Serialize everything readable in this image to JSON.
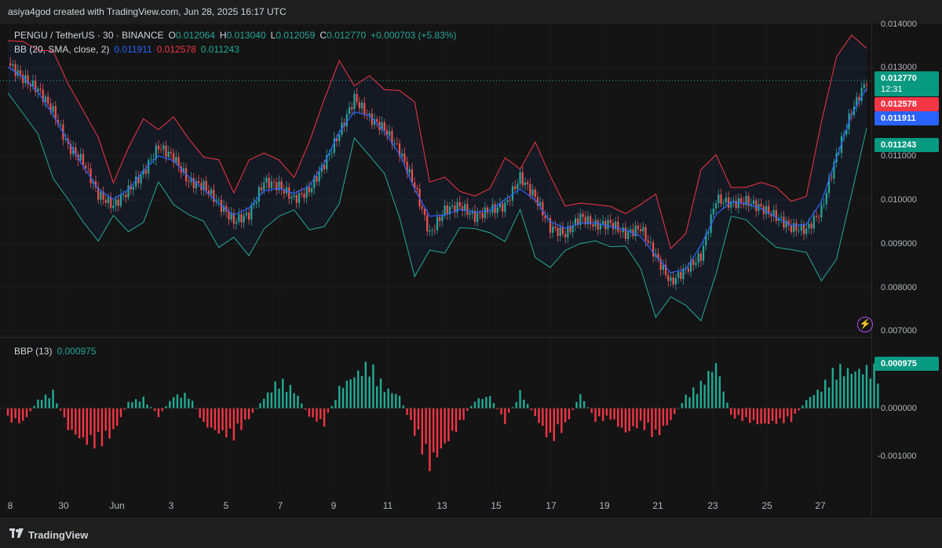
{
  "header": {
    "caption": "asiya4god created with TradingView.com, Jun 28, 2025 16:17 UTC"
  },
  "legend": {
    "symbol": "PENGU / TetherUS · 30 · BINANCE",
    "o_label": "O",
    "o_value": "0.012064",
    "h_label": "H",
    "h_value": "0.013040",
    "l_label": "L",
    "l_value": "0.012059",
    "c_label": "C",
    "c_value": "0.012770",
    "change": "+0.000703 (+5.83%)",
    "bb_label": "BB (20, SMA, close, 2)",
    "bb_basis": "0.011911",
    "bb_upper": "0.012578",
    "bb_lower": "0.011243",
    "bbp_label": "BBP (13)",
    "bbp_value": "0.000975"
  },
  "price_tags": {
    "last": "0.012770",
    "countdown": "12:31",
    "upper": "0.012578",
    "basis": "0.011911",
    "lower": "0.011243",
    "bbp": "0.000975"
  },
  "colors": {
    "up": "#26a69a",
    "down": "#ef5350",
    "bb_basis": "#2962ff",
    "bb_upper": "#f23645",
    "bb_lower": "#22ab94",
    "bbp_pos": "#22ab94",
    "bbp_neg": "#f23645"
  },
  "footer": {
    "brand": "TradingView"
  },
  "chart_data": [
    {
      "type": "candlestick",
      "title": "PENGU / TetherUS · 30 · BINANCE",
      "x_ticks": [
        "8",
        "30",
        "Jun",
        "3",
        "5",
        "7",
        "9",
        "11",
        "13",
        "15",
        "17",
        "19",
        "21",
        "23",
        "25",
        "27"
      ],
      "y_ticks": [
        "0.014000",
        "0.013000",
        "0.011000",
        "0.010000",
        "0.009000",
        "0.008000",
        "0.007000"
      ],
      "ylim": [
        0.007,
        0.014
      ],
      "close_series": [
        {
          "x": 0,
          "y": 0.0131
        },
        {
          "x": 1,
          "y": 0.01275
        },
        {
          "x": 2,
          "y": 0.0125
        },
        {
          "x": 3,
          "y": 0.012
        },
        {
          "x": 4,
          "y": 0.0112
        },
        {
          "x": 5,
          "y": 0.01085
        },
        {
          "x": 6,
          "y": 0.0101
        },
        {
          "x": 7,
          "y": 0.00985
        },
        {
          "x": 8,
          "y": 0.0102
        },
        {
          "x": 9,
          "y": 0.0106
        },
        {
          "x": 10,
          "y": 0.0112
        },
        {
          "x": 11,
          "y": 0.01095
        },
        {
          "x": 12,
          "y": 0.0104
        },
        {
          "x": 13,
          "y": 0.0103
        },
        {
          "x": 14,
          "y": 0.0099
        },
        {
          "x": 15,
          "y": 0.0095
        },
        {
          "x": 16,
          "y": 0.00965
        },
        {
          "x": 17,
          "y": 0.0104
        },
        {
          "x": 18,
          "y": 0.0103
        },
        {
          "x": 19,
          "y": 0.01
        },
        {
          "x": 20,
          "y": 0.0102
        },
        {
          "x": 21,
          "y": 0.0108
        },
        {
          "x": 22,
          "y": 0.0115
        },
        {
          "x": 23,
          "y": 0.0123
        },
        {
          "x": 24,
          "y": 0.01185
        },
        {
          "x": 25,
          "y": 0.0116
        },
        {
          "x": 26,
          "y": 0.0111
        },
        {
          "x": 27,
          "y": 0.0103
        },
        {
          "x": 28,
          "y": 0.0092
        },
        {
          "x": 29,
          "y": 0.00975
        },
        {
          "x": 30,
          "y": 0.00985
        },
        {
          "x": 31,
          "y": 0.0096
        },
        {
          "x": 32,
          "y": 0.00975
        },
        {
          "x": 33,
          "y": 0.00985
        },
        {
          "x": 34,
          "y": 0.0105
        },
        {
          "x": 35,
          "y": 0.01005
        },
        {
          "x": 36,
          "y": 0.00935
        },
        {
          "x": 37,
          "y": 0.0092
        },
        {
          "x": 38,
          "y": 0.0096
        },
        {
          "x": 39,
          "y": 0.0094
        },
        {
          "x": 40,
          "y": 0.00945
        },
        {
          "x": 41,
          "y": 0.0092
        },
        {
          "x": 42,
          "y": 0.00935
        },
        {
          "x": 43,
          "y": 0.0087
        },
        {
          "x": 44,
          "y": 0.0081
        },
        {
          "x": 45,
          "y": 0.0084
        },
        {
          "x": 46,
          "y": 0.0087
        },
        {
          "x": 47,
          "y": 0.01
        },
        {
          "x": 48,
          "y": 0.0099
        },
        {
          "x": 49,
          "y": 0.00995
        },
        {
          "x": 50,
          "y": 0.0098
        },
        {
          "x": 51,
          "y": 0.0096
        },
        {
          "x": 52,
          "y": 0.00935
        },
        {
          "x": 53,
          "y": 0.0093
        },
        {
          "x": 54,
          "y": 0.00975
        },
        {
          "x": 55,
          "y": 0.011
        },
        {
          "x": 56,
          "y": 0.012
        },
        {
          "x": 57,
          "y": 0.0127
        }
      ]
    },
    {
      "type": "bar",
      "title": "BBP (13)",
      "y_ticks": [
        "0.000000",
        "-0.001000"
      ],
      "ylim": [
        -0.0016,
        0.0012
      ],
      "values": [
        -0.0003,
        -0.00035,
        0.0002,
        0.0004,
        -0.0005,
        -0.0008,
        -0.0009,
        -0.0006,
        0.00015,
        0.00025,
        -0.0002,
        0.0003,
        0.00035,
        -0.0004,
        -0.0006,
        -0.0007,
        -0.00025,
        0.00025,
        0.0007,
        0.00045,
        -0.0002,
        -0.0004,
        0.0005,
        0.0008,
        0.0011,
        0.0005,
        0.0003,
        -0.0006,
        -0.0014,
        -0.0009,
        -0.0004,
        0.0002,
        0.0003,
        -0.00035,
        0.0004,
        -0.0002,
        -0.0008,
        -0.00045,
        0.00035,
        -0.0003,
        -0.00025,
        -0.0006,
        -0.0004,
        -0.0007,
        -0.0003,
        0.0003,
        0.0006,
        0.0011,
        -0.0002,
        -0.0003,
        -0.0004,
        -0.00035,
        -0.0003,
        0.0002,
        0.0005,
        0.001,
        0.0009,
        0.00097
      ]
    }
  ]
}
